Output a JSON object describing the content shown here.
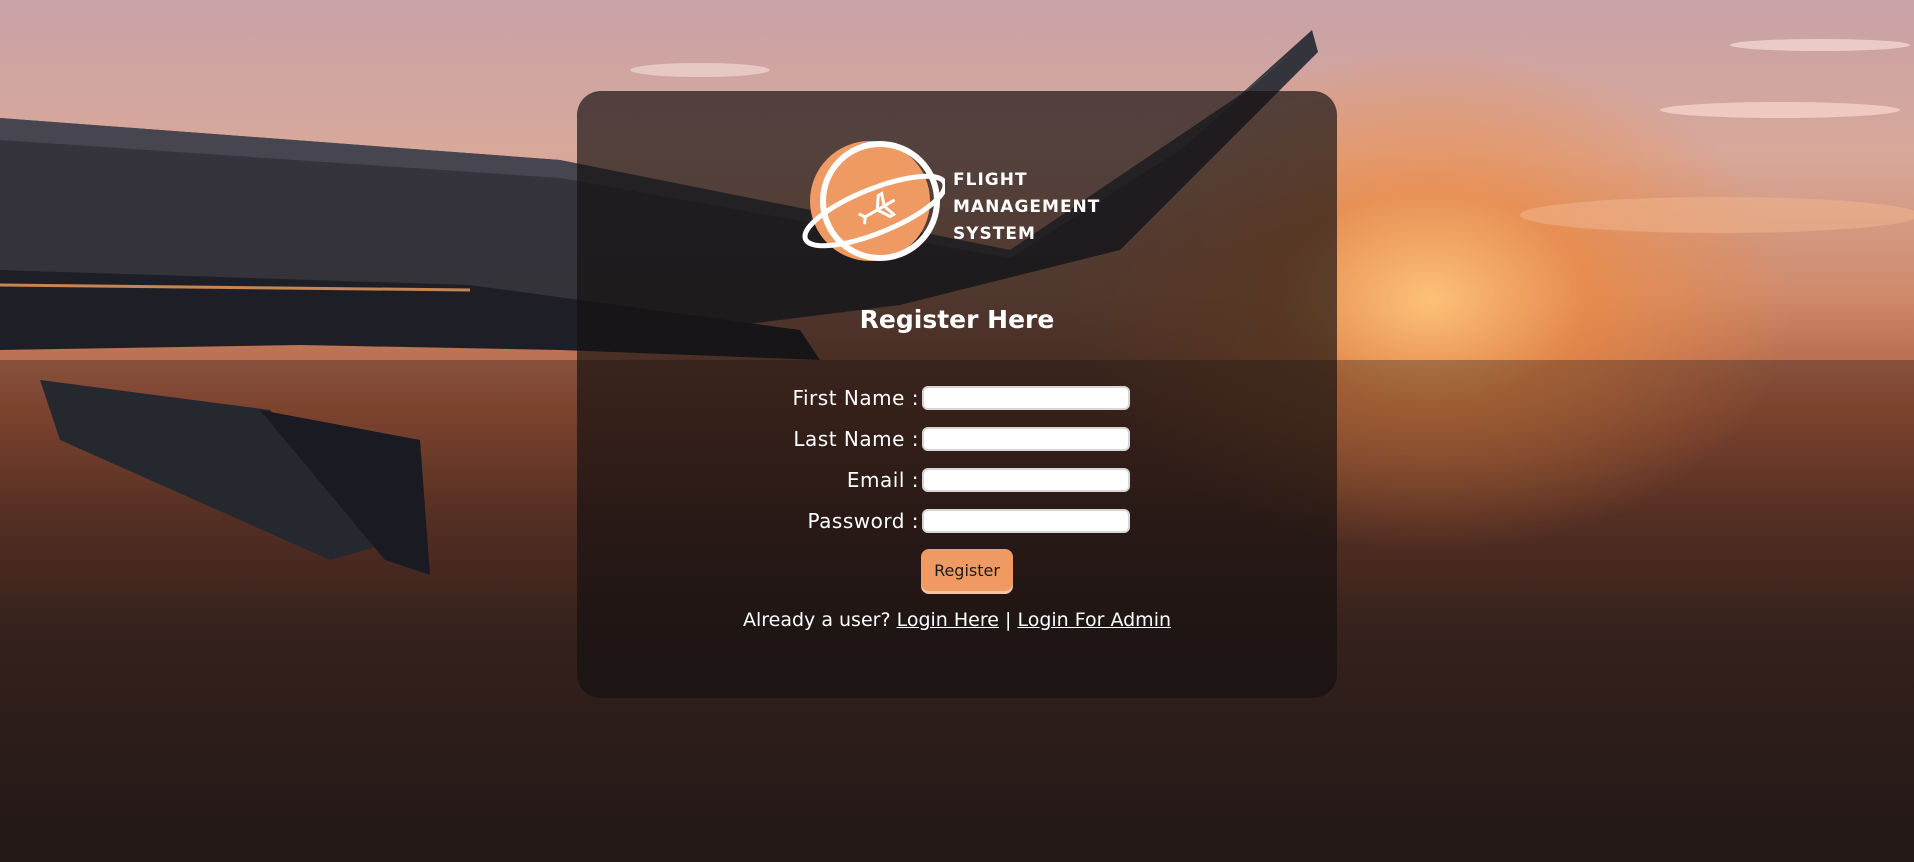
{
  "logo": {
    "line1": "FLIGHT",
    "line2": "MANAGEMENT",
    "line3": "SYSTEM",
    "accent_color": "#ef9a62"
  },
  "form": {
    "title": "Register Here",
    "fields": [
      {
        "label": "First Name :",
        "value": ""
      },
      {
        "label": "Last Name :",
        "value": ""
      },
      {
        "label": "Email :",
        "value": ""
      },
      {
        "label": "Password :",
        "value": ""
      }
    ],
    "submit_label": "Register"
  },
  "footer": {
    "prompt": "Already a user?",
    "login_link": "Login Here",
    "separator": "|",
    "admin_link": "Login For Admin"
  }
}
